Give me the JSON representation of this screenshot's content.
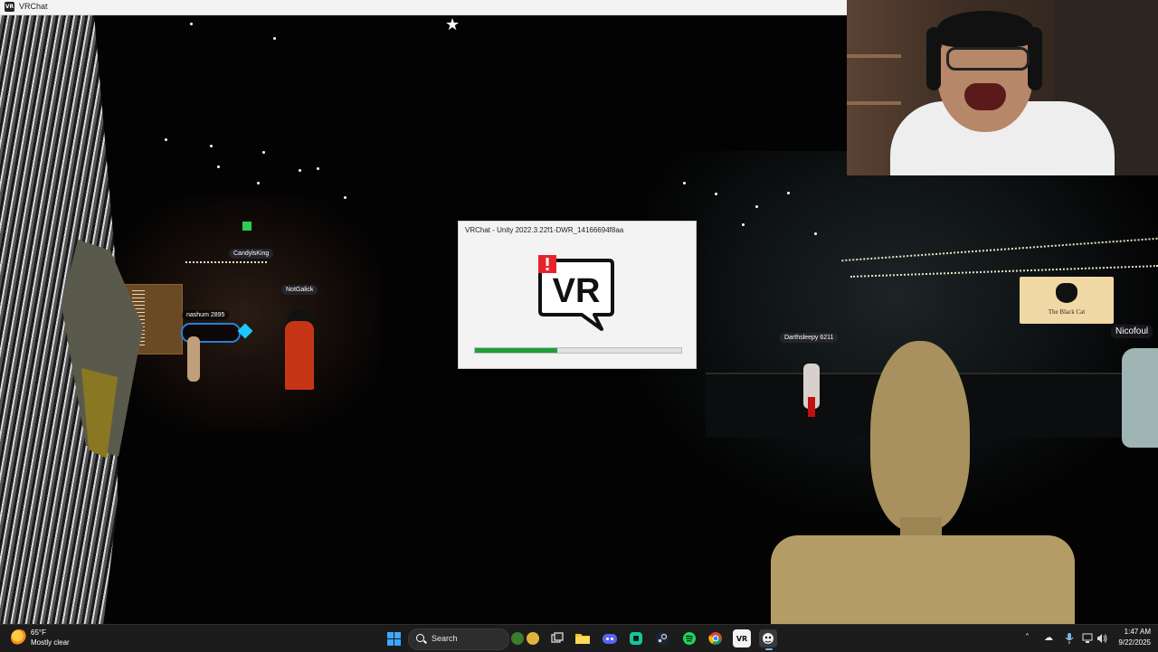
{
  "window": {
    "title": "VRChat",
    "icon_text": "VR"
  },
  "scene": {
    "nameplates": [
      {
        "id": "candy",
        "text": "CandylsKing"
      },
      {
        "id": "notgalick",
        "text": "NotGalick"
      },
      {
        "id": "nash",
        "text": "nashum 2895"
      },
      {
        "id": "darth",
        "text": "Darthsleepy 6211"
      },
      {
        "id": "nicofoul",
        "text": "Nicofoul"
      }
    ],
    "sign": {
      "text": "The Black Cat"
    }
  },
  "dialog": {
    "title": "VRChat - Unity 2022.3.22f1-DWR_14166694f8aa",
    "logo_text": "VR",
    "progress": 0.4
  },
  "taskbar": {
    "weather": {
      "temp": "65°F",
      "condition": "Mostly clear",
      "icon": "sun-icon"
    },
    "search_label": "Search",
    "apps": [
      {
        "name": "start-button",
        "icon": "windows-logo"
      },
      {
        "name": "widgets-icon",
        "icon": "widgets"
      },
      {
        "name": "task-view-icon",
        "icon": "task-view"
      },
      {
        "name": "file-explorer-icon",
        "icon": "folder"
      },
      {
        "name": "discord-icon",
        "icon": "discord",
        "badge": "9+"
      },
      {
        "name": "discord-alt-icon",
        "icon": "discord-alt"
      },
      {
        "name": "steam-icon",
        "icon": "steam"
      },
      {
        "name": "spotify-icon",
        "icon": "spotify"
      },
      {
        "name": "chrome-icon",
        "icon": "chrome"
      },
      {
        "name": "vrchat-taskbar-icon",
        "icon": "vrchat",
        "label": "VR"
      },
      {
        "name": "vrchat-active-icon",
        "icon": "vrchat-cat"
      }
    ],
    "clock": {
      "time": "1:47 AM",
      "date": "9/22/2025"
    }
  },
  "colors": {
    "progress_fill": "#1e9f3c",
    "taskbar_bg": "#1c1c1c",
    "vr_logo_red": "#e8222a",
    "accent_blue": "#3da8ff"
  }
}
